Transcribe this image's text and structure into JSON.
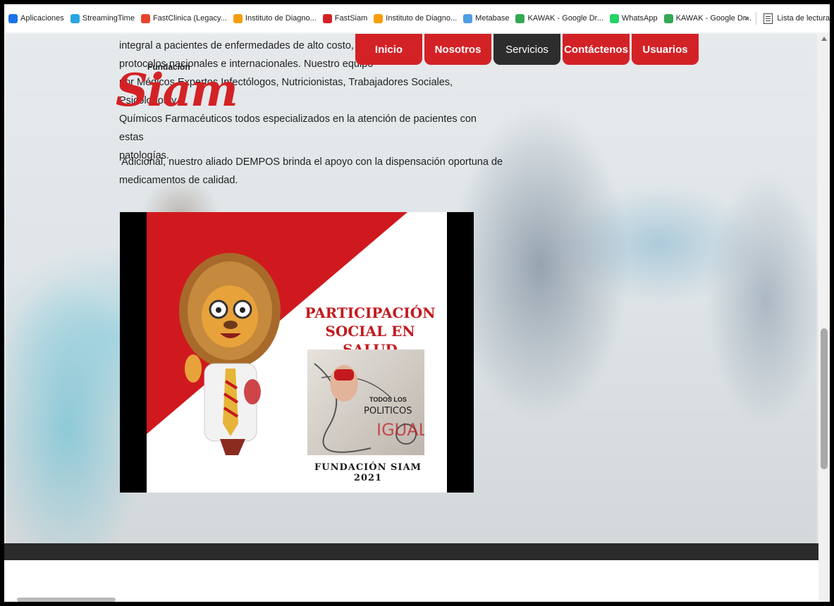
{
  "bookmarks": {
    "items": [
      {
        "label": "Aplicaciones",
        "icon": "apps-grid-icon",
        "color": "#1a73e8"
      },
      {
        "label": "StreamingTime",
        "icon": "streaming-icon",
        "color": "#2aa5e0"
      },
      {
        "label": "FastClinica (Legacy...",
        "icon": "fastclinica-icon",
        "color": "#e8452a"
      },
      {
        "label": "Instituto de Diagno...",
        "icon": "instituto-icon",
        "color": "#f59e0b"
      },
      {
        "label": "FastSiam",
        "icon": "fastsiam-icon",
        "color": "#d32226"
      },
      {
        "label": "Instituto de Diagno...",
        "icon": "instituto-icon",
        "color": "#f59e0b"
      },
      {
        "label": "Metabase",
        "icon": "metabase-icon",
        "color": "#509ee3"
      },
      {
        "label": "KAWAK - Google Dr...",
        "icon": "google-drive-icon",
        "color": "#34a853"
      },
      {
        "label": "WhatsApp",
        "icon": "whatsapp-icon",
        "color": "#25d366"
      },
      {
        "label": "KAWAK - Google Dr...",
        "icon": "google-drive-icon",
        "color": "#34a853"
      }
    ],
    "overflow": "»",
    "reading_list": "Lista de lectura"
  },
  "nav": {
    "items": [
      {
        "label": "Inicio",
        "active": false
      },
      {
        "label": "Nosotros",
        "active": false
      },
      {
        "label": "Servicios",
        "active": true
      },
      {
        "label": "Contáctenos",
        "active": false
      },
      {
        "label": "Usuarios",
        "active": false
      }
    ]
  },
  "logo": {
    "word": "Siam",
    "small": "Fundación"
  },
  "content": {
    "para1_lines": [
      "integral a pacientes de enfermedades de alto costo, de a",
      "protocolos nacionales e internacionales. Nuestro equipo",
      "por Médicos Expertos Infectólogos, Nutricionistas, Trabajadores Sociales, Psicólogos y",
      "Químicos Farmacéuticos todos especializados en la atención de pacientes con estas",
      "patologías."
    ],
    "para2_lines": [
      " Adicional, nuestro aliado DEMPOS brinda el apoyo con la dispensación oportuna de",
      "medicamentos de calidad."
    ]
  },
  "video": {
    "title_line1": "PARTICIPACIÓN",
    "title_line2": "SOCIAL EN SALUD",
    "photo_text_line1": "TODOS LOS",
    "photo_text_line2": "POLITICOS",
    "photo_text_line3": "IGUALES",
    "footer": "FUNDACIÓN SIAM  2021"
  },
  "colors": {
    "brand_red": "#d32226",
    "nav_active": "#2d2d2d"
  }
}
